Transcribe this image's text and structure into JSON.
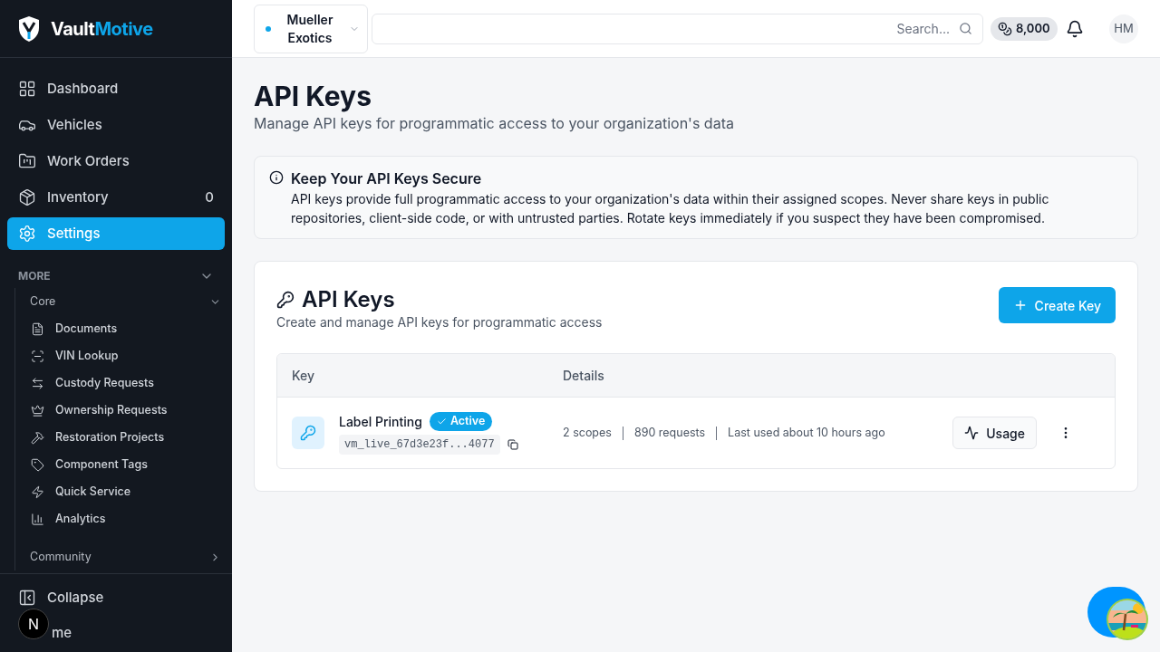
{
  "brand": {
    "first": "Vault",
    "second": "Motive"
  },
  "nav": [
    {
      "label": "Dashboard",
      "selected": false
    },
    {
      "label": "Vehicles",
      "selected": false
    },
    {
      "label": "Work Orders",
      "selected": false
    },
    {
      "label": "Inventory",
      "selected": false,
      "count": "0"
    },
    {
      "label": "Settings",
      "selected": true
    }
  ],
  "more": {
    "title": "MORE",
    "expanded": true,
    "groups": [
      {
        "title": "Core",
        "expanded": true,
        "items": [
          {
            "label": "Documents"
          },
          {
            "label": "VIN Lookup"
          },
          {
            "label": "Custody Requests"
          },
          {
            "label": "Ownership Requests"
          },
          {
            "label": "Restoration Projects"
          },
          {
            "label": "Component Tags"
          },
          {
            "label": "Quick Service"
          },
          {
            "label": "Analytics"
          }
        ]
      },
      {
        "title": "Community",
        "expanded": false
      }
    ]
  },
  "footer": {
    "collapse": "Collapse",
    "theme": "me",
    "badge": "N"
  },
  "topbar": {
    "org": "Mueller Exotics",
    "search_placeholder": "Search...",
    "credits": "8,000",
    "avatar": "HM"
  },
  "page": {
    "title": "API Keys",
    "subtitle": "Manage API keys for programmatic access to your organization's data"
  },
  "alert": {
    "title": "Keep Your API Keys Secure",
    "body": "API keys provide full programmatic access to your organization's data within their assigned scopes. Never share keys in public repositories, client-side code, or with untrusted parties. Rotate keys immediately if you suspect they have been compromised."
  },
  "card": {
    "title": "API Keys",
    "subtitle": "Create and manage API keys for programmatic access",
    "create_button": "Create Key",
    "table": {
      "columns": [
        "Key",
        "Details"
      ],
      "rows": [
        {
          "name": "Label Printing",
          "status": "Active",
          "active": true,
          "key": "vm_live_67d3e23f...4077",
          "scopes": "2 scopes",
          "requests": "890 requests",
          "last_used": "Last used about 10 hours ago",
          "action": "Usage"
        }
      ]
    }
  }
}
